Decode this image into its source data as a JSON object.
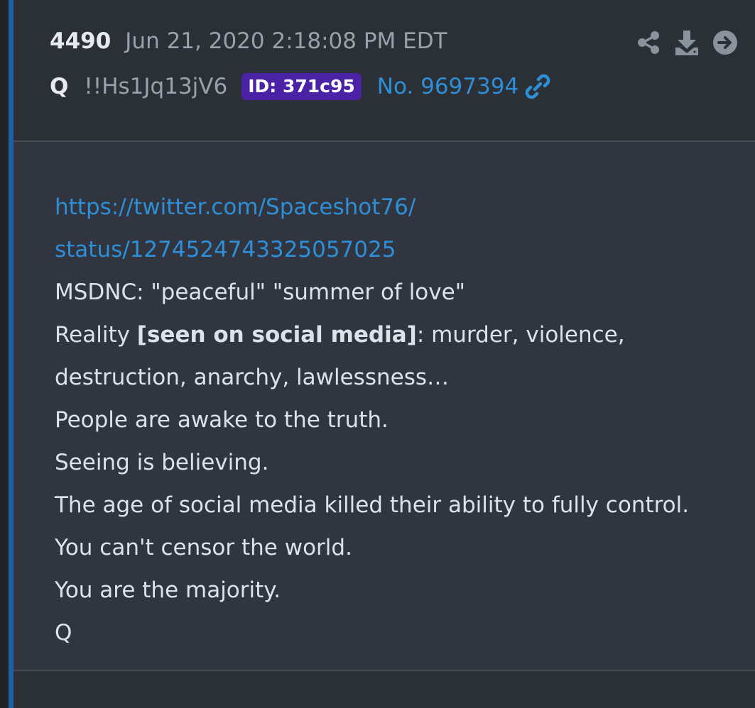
{
  "post": {
    "number": "4490",
    "date": "Jun 21, 2020 2:18:08 PM EDT",
    "author": "Q",
    "tripcode": "!!Hs1Jq13jV6",
    "id_badge": "ID: 371c95",
    "post_no": "No. 9697394"
  },
  "actions": {
    "share_icon": "share-icon",
    "download_icon": "download-icon",
    "forward_icon": "arrow-right-circle-icon",
    "link_icon": "link-icon"
  },
  "body": {
    "link_line1": "https://twitter.com/Spaceshot76/",
    "link_line2": "status/1274524743325057025",
    "line1": "MSDNC: \"peaceful\" \"summer of love\"",
    "line2_prefix": "Reality ",
    "line2_bold": "[seen on social media]",
    "line2_suffix": ": murder, violence,",
    "line3": "destruction, anarchy, lawlessness…",
    "line4": "People are awake to the truth.",
    "line5": "Seeing is believing.",
    "line6": "The age of social media killed their ability to fully control.",
    "line7": "You can't censor the world.",
    "line8": "You are the majority.",
    "signature": "Q"
  },
  "colors": {
    "accent_bar": "#1e5fa6",
    "link": "#2e8fd6",
    "id_badge_bg": "#4b22a6",
    "header_bg": "#2b2f36",
    "body_bg": "#303540",
    "muted_text": "#9aa1ab",
    "icon": "#8a929c"
  }
}
